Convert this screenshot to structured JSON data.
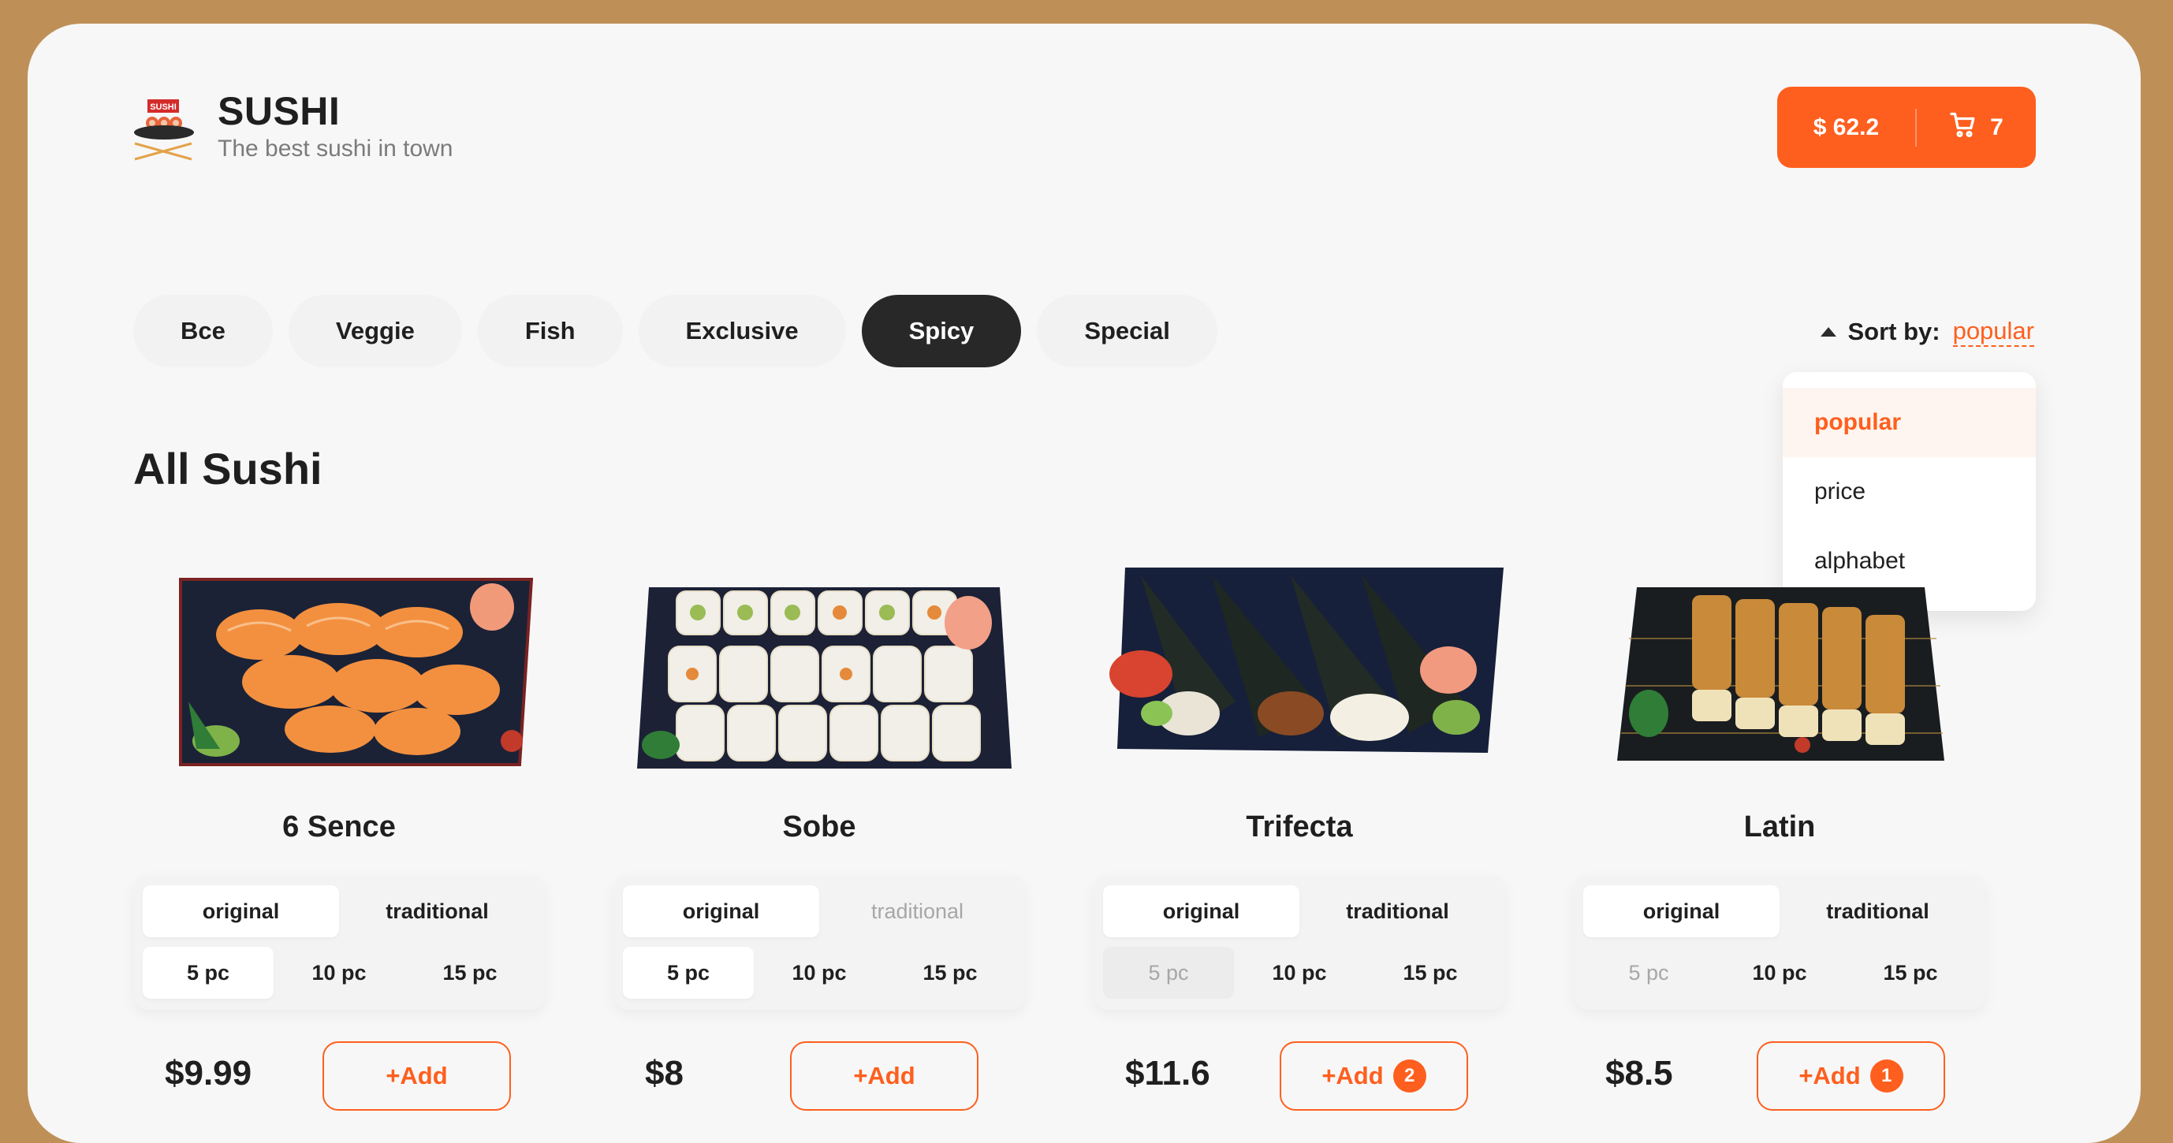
{
  "brand": {
    "title": "SUSHI",
    "subtitle": "The best sushi in town",
    "logo_text": "SUSHI"
  },
  "cart": {
    "total": "$ 62.2",
    "count": "7",
    "icon": "cart-icon"
  },
  "categories": [
    {
      "label": "Все",
      "active": false
    },
    {
      "label": "Veggie",
      "active": false
    },
    {
      "label": "Fish",
      "active": false
    },
    {
      "label": "Exclusive",
      "active": false
    },
    {
      "label": "Spicy",
      "active": true
    },
    {
      "label": "Special",
      "active": false
    }
  ],
  "sort": {
    "label": "Sort by:",
    "value": "popular",
    "options": [
      "popular",
      "price",
      "alphabet"
    ]
  },
  "section_title": "All Sushi",
  "products": [
    {
      "name": "6 Sence",
      "price": "$9.99",
      "add_label": "+Add",
      "count": "",
      "types": [
        {
          "label": "original",
          "state": "selected"
        },
        {
          "label": "traditional",
          "state": "normal"
        }
      ],
      "sizes": [
        {
          "label": "5 pc",
          "state": "selected"
        },
        {
          "label": "10 pc",
          "state": "normal"
        },
        {
          "label": "15 pc",
          "state": "normal"
        }
      ]
    },
    {
      "name": "Sobe",
      "price": "$8",
      "add_label": "+Add",
      "count": "",
      "types": [
        {
          "label": "original",
          "state": "selected"
        },
        {
          "label": "traditional",
          "state": "disabled"
        }
      ],
      "sizes": [
        {
          "label": "5 pc",
          "state": "selected"
        },
        {
          "label": "10 pc",
          "state": "normal"
        },
        {
          "label": "15 pc",
          "state": "normal"
        }
      ]
    },
    {
      "name": "Trifecta",
      "price": "$11.6",
      "add_label": "+Add",
      "count": "2",
      "types": [
        {
          "label": "original",
          "state": "selected"
        },
        {
          "label": "traditional",
          "state": "normal"
        }
      ],
      "sizes": [
        {
          "label": "5 pc",
          "state": "disabled"
        },
        {
          "label": "10 pc",
          "state": "normal"
        },
        {
          "label": "15 pc",
          "state": "normal"
        }
      ]
    },
    {
      "name": "Latin",
      "price": "$8.5",
      "add_label": "+Add",
      "count": "1",
      "types": [
        {
          "label": "original",
          "state": "selected"
        },
        {
          "label": "traditional",
          "state": "normal"
        }
      ],
      "sizes": [
        {
          "label": "5 pc",
          "state": "disabled"
        },
        {
          "label": "10 pc",
          "state": "normal"
        },
        {
          "label": "15 pc",
          "state": "normal"
        }
      ]
    }
  ],
  "colors": {
    "accent": "#fe5f1e",
    "frame": "#be9058",
    "dark": "#282828",
    "page": "#f7f7f7"
  }
}
